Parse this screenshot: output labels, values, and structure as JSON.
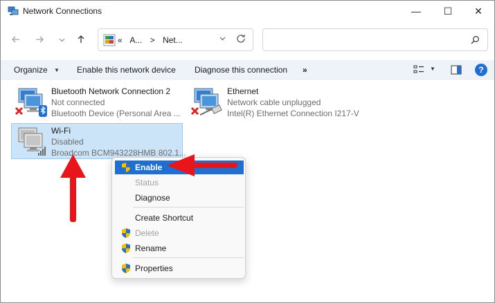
{
  "window": {
    "title": "Network Connections",
    "buttons": {
      "minimize": "—",
      "maximize": "☐",
      "close": "✕"
    }
  },
  "nav": {
    "breadcrumb": [
      "«",
      "A...",
      ">",
      "Net..."
    ],
    "search_placeholder": ""
  },
  "commandbar": {
    "organize": "Organize",
    "enable": "Enable this network device",
    "diagnose": "Diagnose this connection",
    "more": "»",
    "help": "?"
  },
  "adapters": [
    {
      "name": "Bluetooth Network Connection 2",
      "status": "Not connected",
      "device": "Bluetooth Device (Personal Area ...",
      "badge": "x-badge-icon",
      "overlay": "bluetooth-icon"
    },
    {
      "name": "Ethernet",
      "status": "Network cable unplugged",
      "device": "Intel(R) Ethernet Connection I217-V",
      "badge": "x-badge-icon",
      "overlay": "ethernet-cable-icon"
    },
    {
      "name": "Wi-Fi",
      "status": "Disabled",
      "device": "Broadcom BCM943228HMB 802.1...",
      "overlay": "wifi-signal-icon",
      "selected": true
    }
  ],
  "context_menu": {
    "items": [
      {
        "label": "Enable",
        "shield": true,
        "highlighted": true
      },
      {
        "label": "Status",
        "disabled": true
      },
      {
        "label": "Diagnose"
      },
      {
        "label": "Create Shortcut"
      },
      {
        "label": "Delete",
        "shield": true,
        "disabled": true
      },
      {
        "label": "Rename",
        "shield": true
      },
      {
        "label": "Properties",
        "shield": true
      }
    ]
  },
  "colors": {
    "accent": "#1f6fd0",
    "selection_bg": "#cce4f7",
    "command_bar_bg": "#eef3f9",
    "annotation_red": "#e8161b"
  }
}
